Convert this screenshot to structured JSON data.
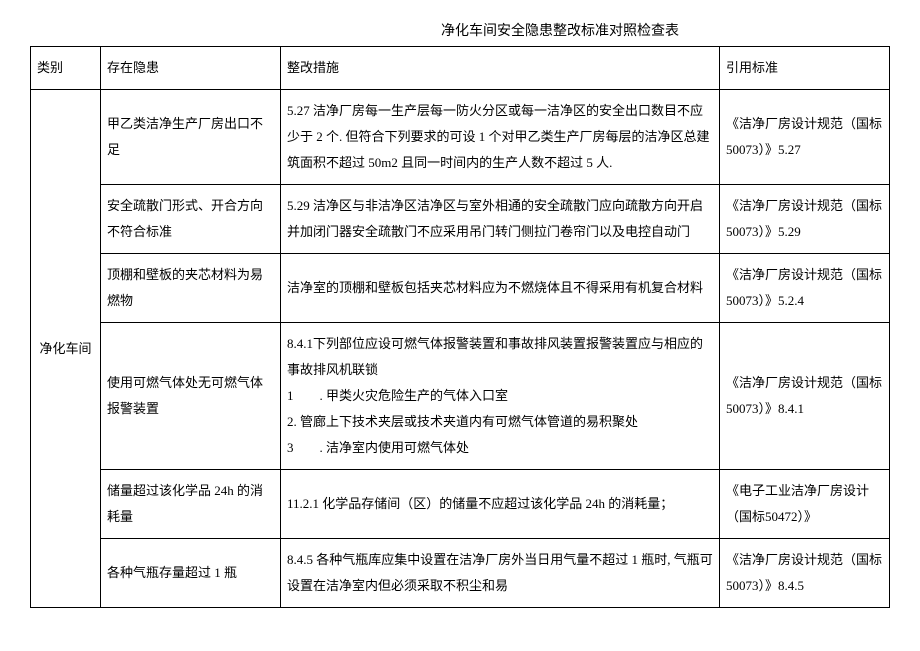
{
  "title": "净化车间安全隐患整改标准对照检查表",
  "headers": {
    "category": "类别",
    "hazard": "存在隐患",
    "measure": "整改措施",
    "standard": "引用标准"
  },
  "category_label": "净化车间",
  "rows": [
    {
      "hazard": "甲乙类洁净生产厂房出口不足",
      "measure": "5.27 洁净厂房每一生产层每一防火分区或每一洁净区的安全出口数目不应少于 2 个. 但符合下列要求的可设 1 个对甲乙类生产厂房每层的洁净区总建筑面积不超过 50m2 且同一时间内的生产人数不超过 5 人.",
      "standard": "《洁净厂房设计规范（国标50073）》5.27"
    },
    {
      "hazard": "安全疏散门形式、开合方向不符合标准",
      "measure": "5.29 洁净区与非洁净区洁净区与室外相通的安全疏散门应向疏散方向开启并加闭门器安全疏散门不应采用吊门转门侧拉门卷帘门以及电控自动门",
      "standard": "《洁净厂房设计规范（国标50073）》5.29"
    },
    {
      "hazard": "顶棚和壁板的夹芯材料为易燃物",
      "measure": "洁净室的顶棚和壁板包括夹芯材料应为不燃烧体且不得采用有机复合材料",
      "standard": "《洁净厂房设计规范（国标50073）》5.2.4"
    },
    {
      "hazard": "使用可燃气体处无可燃气体报警装置",
      "measure": "8.4.1下列部位应设可燃气体报警装置和事故排风装置报警装置应与相应的事故排风机联锁\n1　　. 甲类火灾危险生产的气体入口室\n2. 管廊上下技术夹层或技术夹道内有可燃气体管道的易积聚处\n3　　. 洁净室内使用可燃气体处",
      "standard": "《洁净厂房设计规范（国标50073）》8.4.1"
    },
    {
      "hazard": "储量超过该化学品 24h 的消耗量",
      "measure": "11.2.1 化学品存储间（区）的储量不应超过该化学品 24h 的消耗量；",
      "standard": "《电子工业洁净厂房设计（国标50472）》"
    },
    {
      "hazard": "各种气瓶存量超过 1 瓶",
      "measure": "8.4.5 各种气瓶库应集中设置在洁净厂房外当日用气量不超过 1 瓶时, 气瓶可设置在洁净室内但必须采取不积尘和易",
      "standard": "《洁净厂房设计规范（国标50073）》8.4.5"
    }
  ]
}
